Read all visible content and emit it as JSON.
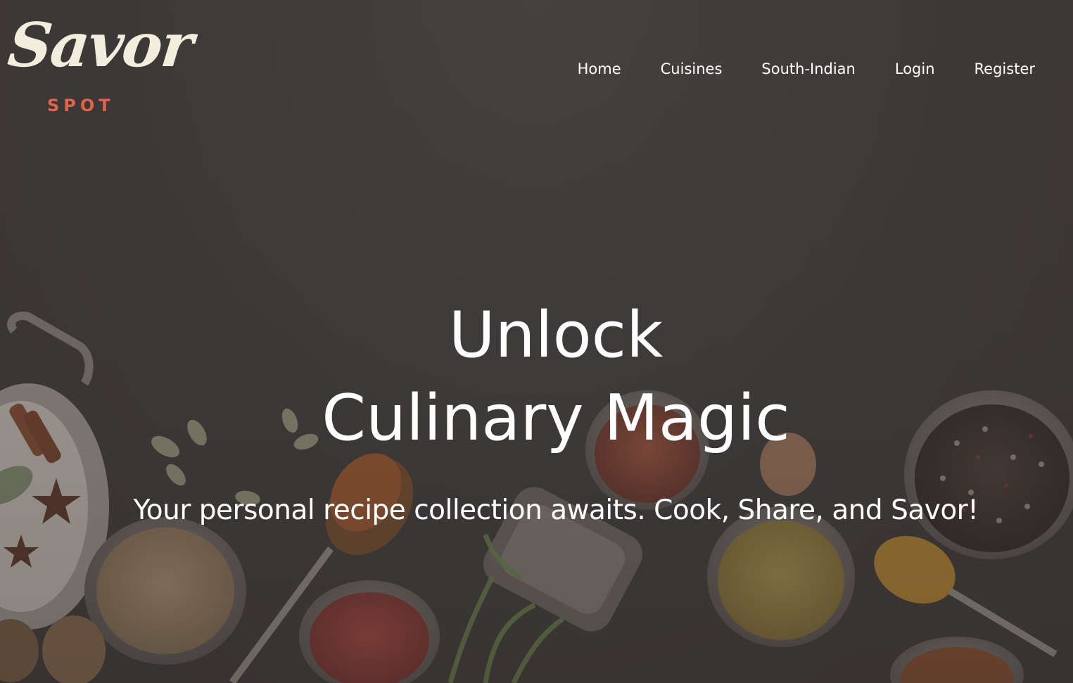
{
  "brand": {
    "script": "Savor",
    "sub": "SPOT",
    "script_color": "#f2eedd",
    "sub_color": "#e4624a"
  },
  "nav": {
    "items": [
      {
        "label": "Home"
      },
      {
        "label": "Cuisines"
      },
      {
        "label": "South-Indian"
      },
      {
        "label": "Login"
      },
      {
        "label": "Register"
      }
    ]
  },
  "hero": {
    "title_line1": "Unlock",
    "title_line2": "Culinary Magic",
    "tagline": "Your personal recipe collection awaits. Cook, Share, and Savor!",
    "background": "spices-on-dark-table-photo"
  }
}
